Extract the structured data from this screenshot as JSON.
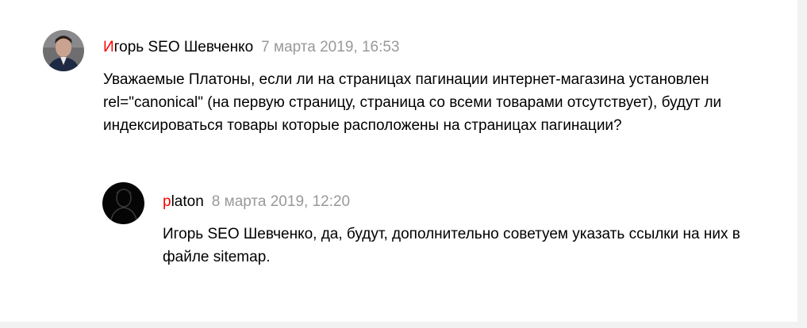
{
  "comments": [
    {
      "author_first_letter": "И",
      "author_rest": "горь SEO Шевченко",
      "date": "7 марта 2019, 16:53",
      "text": "Уважаемые Платоны, если ли на страницах пагинации интернет-магазина установлен rel=\"canonical\" (на первую страницу, страница со всеми товарами отсутствует), будут ли индексироваться товары которые расположены на страницах пагинации?",
      "avatar_icon": "user-photo"
    },
    {
      "author_first_letter": "p",
      "author_rest": "laton",
      "date": "8 марта 2019, 12:20",
      "mention": "Игорь SEO Шевченко",
      "text": ", да, будут, дополнительно советуем указать ссылки на них в файле sitemap.",
      "avatar_icon": "platon-photo"
    }
  ],
  "colors": {
    "author_accent": "#ff0000",
    "date": "#999999",
    "background": "#f2f2f2",
    "card": "#ffffff"
  }
}
